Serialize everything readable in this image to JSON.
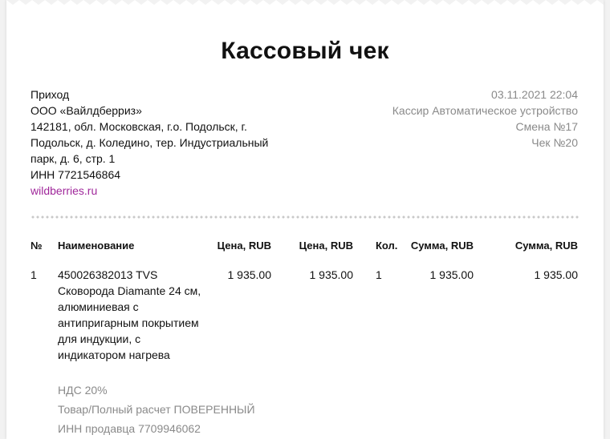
{
  "title": "Кассовый чек",
  "seller": {
    "operation": "Приход",
    "company": "ООО «Вайлдберриз»",
    "address": "142181, обл. Московская, г.о. Подольск, г. Подольск, д. Коледино, тер. Индустриальный парк, д. 6, стр. 1",
    "inn": "ИНН 7721546864",
    "site": "wildberries.ru"
  },
  "meta": {
    "datetime": "03.11.2021 22:04",
    "cashier": "Кассир Автоматическое устройство",
    "shift": "Смена №17",
    "check": "Чек №20"
  },
  "table": {
    "headers": [
      "№",
      "Наименование",
      "Цена, RUB",
      "Цена, RUB",
      "Кол.",
      "Сумма, RUB",
      "Сумма, RUB"
    ],
    "rows": [
      {
        "no": "1",
        "name": "450026382013 TVS Сковорода Diamante 24 см, алюминиевая с антипригарным покрытием для индукции, с индикатором нагрева",
        "price1": "1 935.00",
        "price2": "1 935.00",
        "qty": "1",
        "sum1": "1 935.00",
        "sum2": "1 935.00",
        "vat": "НДС 20%",
        "payment": "Товар/Полный расчет ПОВЕРЕННЫЙ",
        "seller_inn": "ИНН продавца 7709946062"
      }
    ]
  },
  "colors": {
    "link": "#a0289b",
    "muted": "#8a8a8a"
  }
}
